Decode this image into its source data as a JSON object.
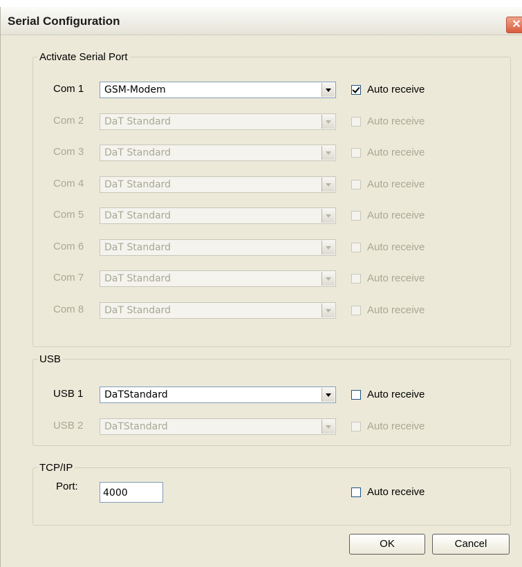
{
  "window": {
    "title": "Serial Configuration",
    "close_glyph": "✕"
  },
  "serial": {
    "legend": "Activate Serial Port",
    "rows": [
      {
        "label": "Com 1",
        "value": "GSM-Modem",
        "auto_label": "Auto receive",
        "checked": true,
        "enabled": true
      },
      {
        "label": "Com 2",
        "value": "DaT Standard",
        "auto_label": "Auto receive",
        "checked": false,
        "enabled": false
      },
      {
        "label": "Com 3",
        "value": "DaT Standard",
        "auto_label": "Auto receive",
        "checked": false,
        "enabled": false
      },
      {
        "label": "Com 4",
        "value": "DaT Standard",
        "auto_label": "Auto receive",
        "checked": false,
        "enabled": false
      },
      {
        "label": "Com 5",
        "value": "DaT Standard",
        "auto_label": "Auto receive",
        "checked": false,
        "enabled": false
      },
      {
        "label": "Com 6",
        "value": "DaT Standard",
        "auto_label": "Auto receive",
        "checked": false,
        "enabled": false
      },
      {
        "label": "Com 7",
        "value": "DaT Standard",
        "auto_label": "Auto receive",
        "checked": false,
        "enabled": false
      },
      {
        "label": "Com 8",
        "value": "DaT Standard",
        "auto_label": "Auto receive",
        "checked": false,
        "enabled": false
      }
    ]
  },
  "usb": {
    "legend": "USB",
    "rows": [
      {
        "label": "USB 1",
        "value": "DaTStandard",
        "auto_label": "Auto receive",
        "checked": false,
        "enabled": true
      },
      {
        "label": "USB 2",
        "value": "DaTStandard",
        "auto_label": "Auto receive",
        "checked": false,
        "enabled": false
      }
    ]
  },
  "tcp": {
    "legend": "TCP/IP",
    "port_label": "Port:",
    "port_value": "4000",
    "auto_label": "Auto receive",
    "checked": false
  },
  "buttons": {
    "ok": "OK",
    "cancel": "Cancel"
  }
}
